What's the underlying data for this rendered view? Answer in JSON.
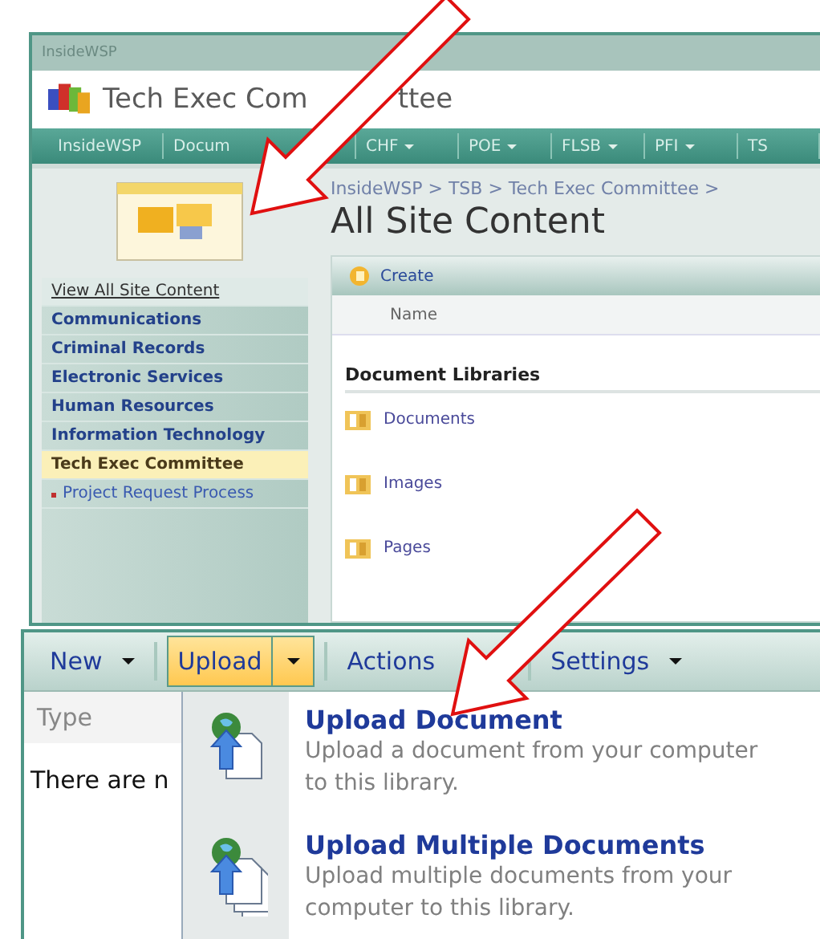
{
  "site": {
    "window_title": "InsideWSP",
    "title_parts": [
      "Tech Exec Com",
      "ttee"
    ],
    "nav": [
      {
        "label": "InsideWSP",
        "dropdown": false
      },
      {
        "label": "Docum",
        "dropdown": false
      },
      {
        "label": "CHF",
        "dropdown": true
      },
      {
        "label": "POE",
        "dropdown": true
      },
      {
        "label": "FLSB",
        "dropdown": true
      },
      {
        "label": "PFI",
        "dropdown": true
      },
      {
        "label": "TS",
        "dropdown": false
      }
    ]
  },
  "page": {
    "breadcrumb": "InsideWSP > TSB > Tech Exec Committee >",
    "title": "All Site Content"
  },
  "sidebar": {
    "items": [
      {
        "label": "View All Site Content",
        "kind": "link",
        "selected": false
      },
      {
        "label": "Communications",
        "kind": "heading",
        "selected": false
      },
      {
        "label": "Criminal Records",
        "kind": "heading",
        "selected": false
      },
      {
        "label": "Electronic Services",
        "kind": "heading",
        "selected": false
      },
      {
        "label": "Human Resources",
        "kind": "heading",
        "selected": false
      },
      {
        "label": "Information Technology",
        "kind": "heading",
        "selected": false
      },
      {
        "label": "Tech Exec Committee",
        "kind": "heading",
        "selected": true
      },
      {
        "label": "Project Request Process",
        "kind": "bullet",
        "selected": false
      }
    ]
  },
  "content": {
    "create": "Create",
    "column": "Name",
    "section": "Document Libraries",
    "libraries": [
      "Documents",
      "Images",
      "Pages"
    ]
  },
  "library_toolbar": {
    "buttons": [
      {
        "label": "New",
        "selected": false,
        "dropdown": true
      },
      {
        "label": "Upload",
        "selected": true,
        "dropdown": true
      },
      {
        "label": "Actions",
        "selected": false,
        "dropdown": false
      },
      {
        "label": "Settings",
        "selected": false,
        "dropdown": true
      }
    ]
  },
  "list": {
    "column": "Type",
    "empty_text": "There are n"
  },
  "upload_menu": {
    "items": [
      {
        "kind": "single",
        "title": "Upload Document",
        "description": "Upload a document from your computer to this library."
      },
      {
        "kind": "multiple",
        "title": "Upload Multiple Documents",
        "description": "Upload multiple documents from your computer to this library."
      }
    ]
  }
}
